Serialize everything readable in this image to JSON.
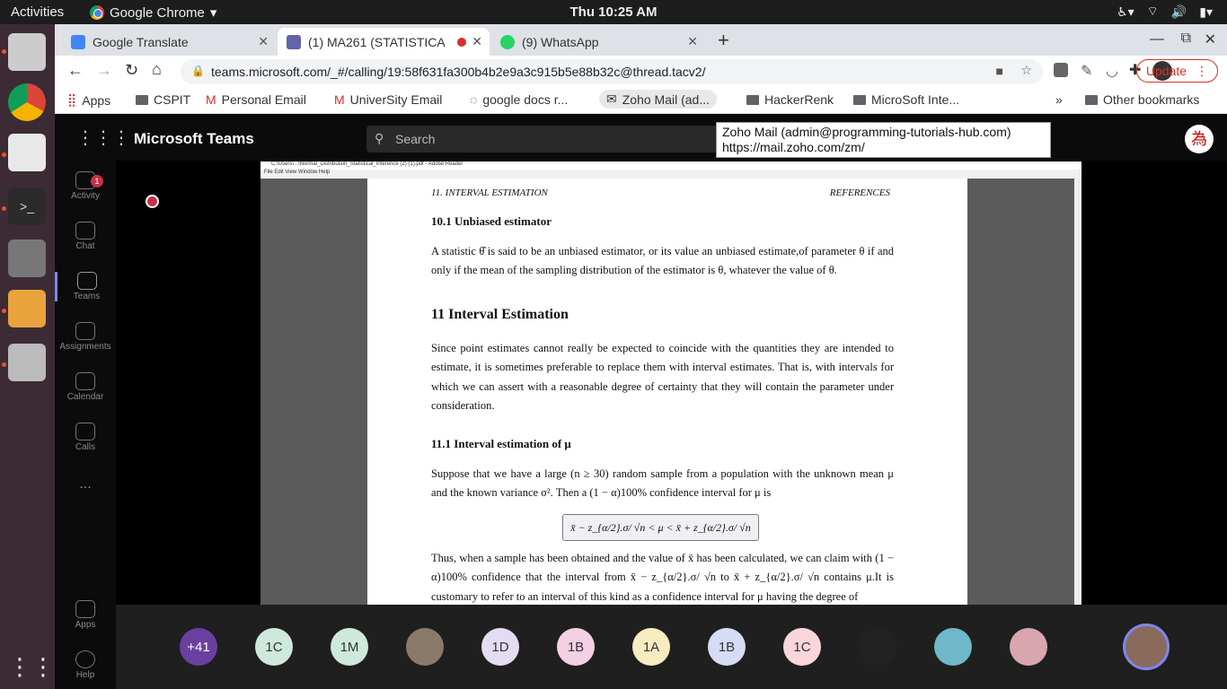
{
  "os": {
    "activities": "Activities",
    "app_name": "Google Chrome",
    "clock": "Thu 10:25 AM"
  },
  "tabs": [
    {
      "title": "Google Translate",
      "color": "#4285f4"
    },
    {
      "title": "(1) MA261 (STATISTICA",
      "color": "#6264a7"
    },
    {
      "title": "(9) WhatsApp",
      "color": "#25d366"
    }
  ],
  "omnibox": {
    "url": "teams.microsoft.com/_#/calling/19:58f631fa300b4b2e9a3c915b5e88b32c@thread.tacv2/"
  },
  "bookmarks": {
    "items": [
      "Apps",
      "CSPIT",
      "Personal Email",
      "UniverSity Email",
      "google docs r...",
      "Zoho Mail (ad...",
      "HackerRenk",
      "MicroSoft Inte..."
    ],
    "other": "Other bookmarks",
    "more": "»",
    "update": "Update"
  },
  "tooltip": {
    "line1": "Zoho Mail (admin@programming-tutorials-hub.com)",
    "line2": "https://mail.zoho.com/zm/"
  },
  "teams": {
    "title": "Microsoft Teams",
    "search_placeholder": "Search",
    "rail": [
      {
        "label": "Activity",
        "badge": "1"
      },
      {
        "label": "Chat"
      },
      {
        "label": "Teams"
      },
      {
        "label": "Assignments"
      },
      {
        "label": "Calendar"
      },
      {
        "label": "Calls"
      },
      {
        "label": "..."
      },
      {
        "label": "Apps"
      },
      {
        "label": "Help"
      }
    ]
  },
  "pdf": {
    "window_title": "C:\\Users\\...\\Normal_Distribution_Statistical_Inference (2) (1).pdf - Adobe Reader",
    "menu": "File   Edit   View   Window   Help",
    "header_left": "11.  INTERVAL ESTIMATION",
    "header_right": "REFERENCES",
    "sec_10_1": "10.1    Unbiased estimator",
    "para1": "A statistic θ̂ is said to be an unbiased estimator, or its value an unbiased estimate,of parameter θ if and only if the mean of the sampling distribution of the estimator is θ, whatever the value of θ.",
    "sec_11": "11    Interval Estimation",
    "para2": "Since point estimates cannot really be expected to coincide with the quantities they are intended to estimate, it is sometimes preferable to replace them with interval estimates. That is, with intervals for which we can assert with a reasonable degree of certainty that they will contain the parameter under consideration.",
    "sec_11_1": "11.1    Interval estimation of μ",
    "para3": "Suppose that we have a large (n ≥ 30) random sample from a population with the unknown mean μ and the known variance σ². Then a (1 − α)100% confidence interval for μ is",
    "formula": "x̄ − z_{α/2}.σ/ √n < μ < x̄ + z_{α/2}.σ/ √n",
    "para4": "Thus, when a sample has been obtained and the value of x̄ has been calculated, we can claim with (1 − α)100% confidence that the interval from x̄ − z_{α/2}.σ/ √n to x̄ + z_{α/2}.σ/ √n contains μ.It is customary to refer to an interval of this kind as a confidence interval for μ having the degree of"
  },
  "participants": [
    {
      "label": "+41",
      "bg": "#6b3fa0",
      "fg": "#ffffff"
    },
    {
      "label": "1C",
      "bg": "#cfe8dc",
      "fg": "#333"
    },
    {
      "label": "1M",
      "bg": "#cfe8dc",
      "fg": "#333"
    },
    {
      "label": "",
      "bg": "#8a7a6a",
      "fg": "#fff"
    },
    {
      "label": "1D",
      "bg": "#e4dcf2",
      "fg": "#333"
    },
    {
      "label": "1B",
      "bg": "#f5d0e4",
      "fg": "#333"
    },
    {
      "label": "1A",
      "bg": "#f7ecc0",
      "fg": "#333"
    },
    {
      "label": "1B",
      "bg": "#d6dcf5",
      "fg": "#333"
    },
    {
      "label": "1C",
      "bg": "#f9d6dc",
      "fg": "#333"
    },
    {
      "label": "",
      "bg": "#222",
      "fg": "#fff"
    },
    {
      "label": "",
      "bg": "#6fb8c9",
      "fg": "#fff"
    },
    {
      "label": "",
      "bg": "#d9a6b0",
      "fg": "#fff"
    }
  ]
}
